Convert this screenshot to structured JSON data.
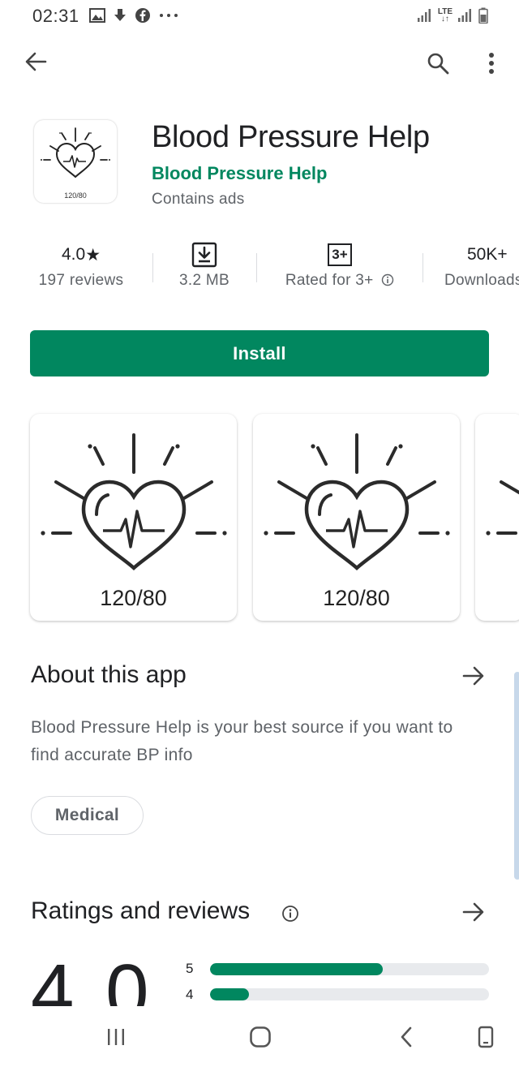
{
  "status_bar": {
    "time": "02:31",
    "network": "LTE"
  },
  "app": {
    "title": "Blood Pressure Help",
    "developer": "Blood Pressure Help",
    "ads_notice": "Contains ads",
    "icon_caption": "120/80"
  },
  "stats": {
    "rating_value": "4.0",
    "rating_star": "★",
    "reviews": "197 reviews",
    "size": "3.2 MB",
    "content_badge": "3+",
    "content_rating": "Rated for 3+",
    "downloads": "50K+",
    "downloads_label": "Downloads"
  },
  "install_label": "Install",
  "screenshots": [
    {
      "caption": "120/80"
    },
    {
      "caption": "120/80"
    }
  ],
  "about": {
    "title": "About this app",
    "description": "Blood Pressure Help is your best source if you want to find accurate BP info",
    "category_chip": "Medical"
  },
  "ratings": {
    "title": "Ratings and reviews",
    "big_rating": "4.0",
    "bars": [
      {
        "label": "5",
        "fraction": 0.62
      },
      {
        "label": "4",
        "fraction": 0.14
      }
    ]
  },
  "colors": {
    "accent": "#01875f",
    "text_primary": "#202124",
    "text_secondary": "#5f6368"
  }
}
